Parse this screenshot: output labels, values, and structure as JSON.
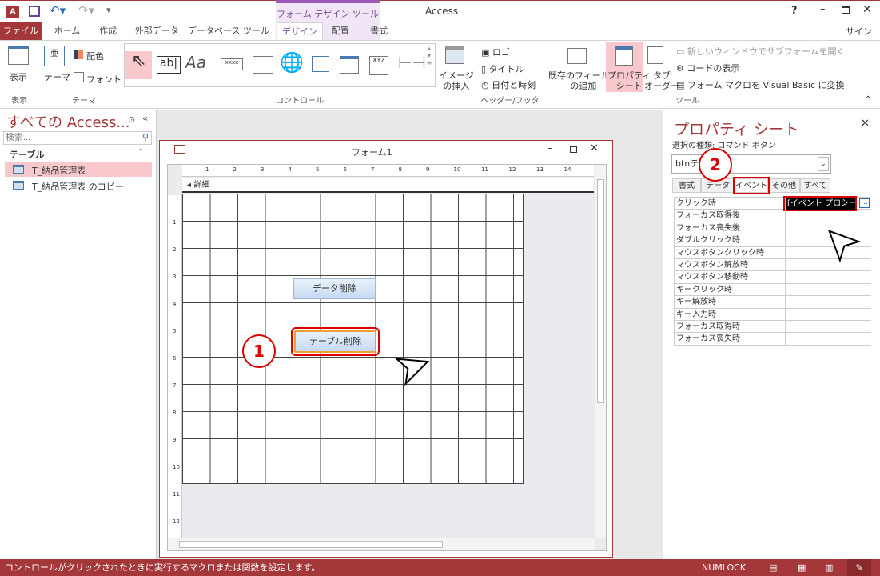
{
  "app": {
    "title": "Access",
    "context_tab_group": "フォーム デザイン ツール",
    "help": "?",
    "signin": "サインイン"
  },
  "tabs": [
    {
      "label": "ファイル"
    },
    {
      "label": "ホーム"
    },
    {
      "label": "作成"
    },
    {
      "label": "外部データ"
    },
    {
      "label": "データベース ツール"
    },
    {
      "label": "デザイン"
    },
    {
      "label": "配置"
    },
    {
      "label": "書式"
    }
  ],
  "ribbon": {
    "view": {
      "label": "表示",
      "group": "表示"
    },
    "theme": {
      "theme": "テーマ",
      "colors": "配色",
      "fonts": "フォント",
      "group": "テーマ"
    },
    "controls": {
      "group": "コントロール",
      "textbox": "ab|",
      "label": "Aa",
      "button": "xxxx",
      "xyz": "XYZ"
    },
    "image": {
      "label1": "イメージ",
      "label2": "の挿入"
    },
    "header_footer": {
      "logo": "ロゴ",
      "title": "タイトル",
      "datetime": "日付と時刻",
      "group": "ヘッダー/フッター"
    },
    "tools": {
      "add_fields1": "既存のフィールド",
      "add_fields2": "の追加",
      "property1": "プロパティ",
      "property2": "シート",
      "tab_order1": "タブ",
      "tab_order2": "オーダー",
      "subform": "新しいウィンドウでサブフォームを開く",
      "view_code": "コードの表示",
      "convert": "フォーム マクロを Visual Basic に変換",
      "group": "ツール"
    }
  },
  "nav": {
    "title": "すべての Access...",
    "search_placeholder": "検索...",
    "section": "テーブル",
    "items": [
      {
        "label": "T_納品管理表",
        "selected": true
      },
      {
        "label": "T_納品管理表 のコピー",
        "selected": false
      }
    ]
  },
  "form": {
    "title": "フォーム1",
    "section": "詳細",
    "ruler": [
      "1",
      "2",
      "3",
      "4",
      "5",
      "6",
      "7",
      "8",
      "9",
      "10",
      "11",
      "12",
      "13",
      "14"
    ],
    "vruler": [
      "1",
      "2",
      "3",
      "4",
      "5",
      "6",
      "7",
      "8",
      "9",
      "10",
      "11",
      "12"
    ],
    "buttons": [
      {
        "label": "データ削除"
      },
      {
        "label": "テーブル削除",
        "selected": true
      }
    ]
  },
  "property_sheet": {
    "title": "プロパティ シート",
    "selection_type": "選択の種類: コマンド ボタン",
    "object": "btnテ",
    "tabs": [
      {
        "label": "書式"
      },
      {
        "label": "データ"
      },
      {
        "label": "イベント",
        "active": true
      },
      {
        "label": "その他"
      },
      {
        "label": "すべて"
      }
    ],
    "rows": [
      {
        "name": "クリック時",
        "value": "[イベント プロシージャ]"
      },
      {
        "name": "フォーカス取得後",
        "value": ""
      },
      {
        "name": "フォーカス喪失後",
        "value": ""
      },
      {
        "name": "ダブルクリック時",
        "value": ""
      },
      {
        "name": "マウスボタンクリック時",
        "value": ""
      },
      {
        "name": "マウスボタン解放時",
        "value": ""
      },
      {
        "name": "マウスボタン移動時",
        "value": ""
      },
      {
        "name": "キークリック時",
        "value": ""
      },
      {
        "name": "キー解放時",
        "value": ""
      },
      {
        "name": "キー入力時",
        "value": ""
      },
      {
        "name": "フォーカス取得時",
        "value": ""
      },
      {
        "name": "フォーカス喪失時",
        "value": ""
      }
    ]
  },
  "annotations": {
    "step1": "1",
    "step2": "2"
  },
  "status": {
    "message": "コントロールがクリックされたときに実行するマクロまたは関数を設定します。",
    "numlock": "NUMLOCK"
  },
  "colors": {
    "accent": "#a4373a",
    "context": "#9b59b6",
    "highlight": "#f8c8cc",
    "annotation": "#dd0000"
  }
}
